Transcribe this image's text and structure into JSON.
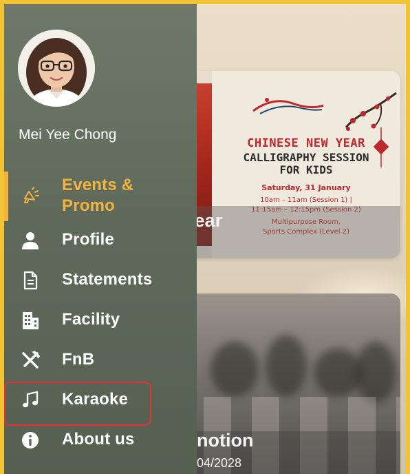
{
  "user": {
    "name": "Mei Yee Chong"
  },
  "menu": [
    {
      "id": "events",
      "label": "Events & Promo",
      "line1": "Events &",
      "line2": "Promo",
      "icon": "megaphone-icon",
      "active": true
    },
    {
      "id": "profile",
      "label": "Profile",
      "icon": "user-icon",
      "active": false
    },
    {
      "id": "statements",
      "label": "Statements",
      "icon": "document-icon",
      "active": false
    },
    {
      "id": "facility",
      "label": "Facility",
      "icon": "building-icon",
      "active": false
    },
    {
      "id": "fnb",
      "label": "FnB",
      "icon": "utensils-icon",
      "active": false
    },
    {
      "id": "karaoke",
      "label": "Karaoke",
      "icon": "music-note-icon",
      "active": false
    },
    {
      "id": "about",
      "label": "About us",
      "icon": "info-icon",
      "active": false
    }
  ],
  "cards": [
    {
      "title_fragment": "w Year",
      "poster": {
        "title": "CHINESE NEW YEAR",
        "subtitle_line1": "CALLIGRAPHY SESSION",
        "subtitle_line2": "FOR KIDS",
        "date": "Saturday, 31 January",
        "time_line1": "10am – 11am (Session 1) |",
        "time_line2": "11:15am – 12:15pm (Session 2)",
        "venue_line1": "Multipurpose Room,",
        "venue_line2": "Sports Complex (Level 2)"
      }
    },
    {
      "title_fragment": "notion",
      "date_fragment": "04/2028"
    }
  ],
  "colors": {
    "accent": "#f3b340",
    "drawer_bg": "#66715f",
    "highlight": "#e4313a",
    "frame": "#f2c335",
    "poster_red": "#c2262d"
  }
}
